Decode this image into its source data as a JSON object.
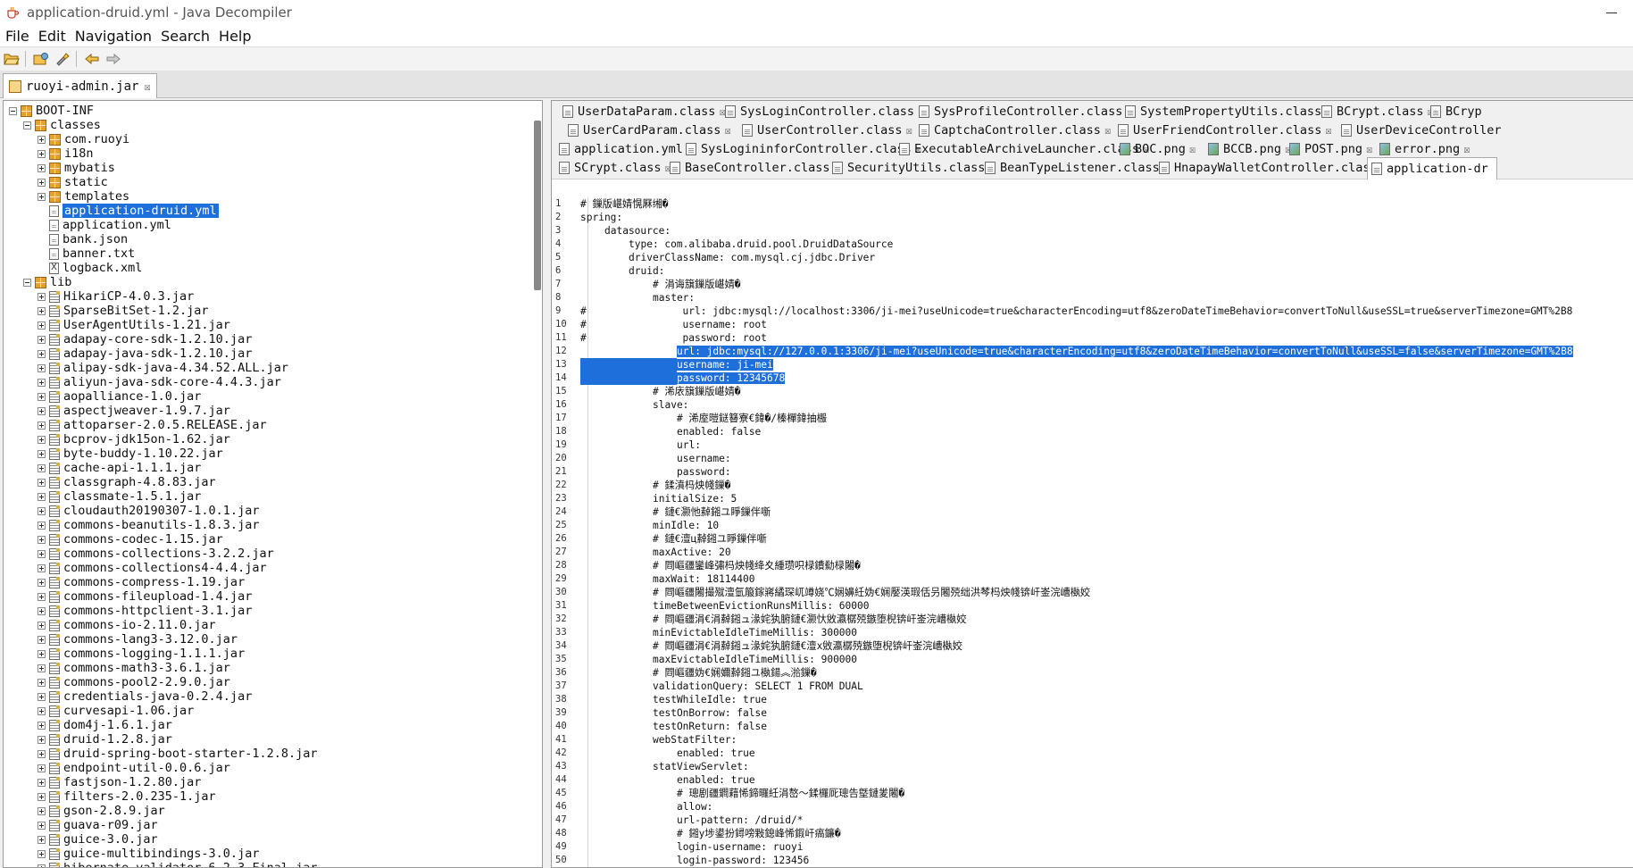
{
  "window": {
    "title": "application-druid.yml - Java Decompiler"
  },
  "menu": [
    "File",
    "Edit",
    "Navigation",
    "Search",
    "Help"
  ],
  "jar_tab": {
    "label": "ruoyi-admin.jar"
  },
  "tree": [
    {
      "label": "BOOT-INF",
      "depth": 0,
      "toggle": "minus",
      "icon": "package"
    },
    {
      "label": "classes",
      "depth": 1,
      "toggle": "minus",
      "icon": "package"
    },
    {
      "label": "com.ruoyi",
      "depth": 2,
      "toggle": "plus",
      "icon": "package"
    },
    {
      "label": "i18n",
      "depth": 2,
      "toggle": "plus",
      "icon": "package"
    },
    {
      "label": "mybatis",
      "depth": 2,
      "toggle": "plus",
      "icon": "package"
    },
    {
      "label": "static",
      "depth": 2,
      "toggle": "plus",
      "icon": "package"
    },
    {
      "label": "templates",
      "depth": 2,
      "toggle": "plus",
      "icon": "package"
    },
    {
      "label": "application-druid.yml",
      "depth": 2,
      "toggle": "none",
      "icon": "file",
      "selected": true
    },
    {
      "label": "application.yml",
      "depth": 2,
      "toggle": "none",
      "icon": "file"
    },
    {
      "label": "bank.json",
      "depth": 2,
      "toggle": "none",
      "icon": "file"
    },
    {
      "label": "banner.txt",
      "depth": 2,
      "toggle": "none",
      "icon": "file"
    },
    {
      "label": "logback.xml",
      "depth": 2,
      "toggle": "none",
      "icon": "xml"
    },
    {
      "label": "lib",
      "depth": 1,
      "toggle": "minus",
      "icon": "package"
    },
    {
      "label": "HikariCP-4.0.3.jar",
      "depth": 2,
      "toggle": "plus",
      "icon": "jar"
    },
    {
      "label": "SparseBitSet-1.2.jar",
      "depth": 2,
      "toggle": "plus",
      "icon": "jar"
    },
    {
      "label": "UserAgentUtils-1.21.jar",
      "depth": 2,
      "toggle": "plus",
      "icon": "jar"
    },
    {
      "label": "adapay-core-sdk-1.2.10.jar",
      "depth": 2,
      "toggle": "plus",
      "icon": "jar"
    },
    {
      "label": "adapay-java-sdk-1.2.10.jar",
      "depth": 2,
      "toggle": "plus",
      "icon": "jar"
    },
    {
      "label": "alipay-sdk-java-4.34.52.ALL.jar",
      "depth": 2,
      "toggle": "plus",
      "icon": "jar"
    },
    {
      "label": "aliyun-java-sdk-core-4.4.3.jar",
      "depth": 2,
      "toggle": "plus",
      "icon": "jar"
    },
    {
      "label": "aopalliance-1.0.jar",
      "depth": 2,
      "toggle": "plus",
      "icon": "jar"
    },
    {
      "label": "aspectjweaver-1.9.7.jar",
      "depth": 2,
      "toggle": "plus",
      "icon": "jar"
    },
    {
      "label": "attoparser-2.0.5.RELEASE.jar",
      "depth": 2,
      "toggle": "plus",
      "icon": "jar"
    },
    {
      "label": "bcprov-jdk15on-1.62.jar",
      "depth": 2,
      "toggle": "plus",
      "icon": "jar"
    },
    {
      "label": "byte-buddy-1.10.22.jar",
      "depth": 2,
      "toggle": "plus",
      "icon": "jar"
    },
    {
      "label": "cache-api-1.1.1.jar",
      "depth": 2,
      "toggle": "plus",
      "icon": "jar"
    },
    {
      "label": "classgraph-4.8.83.jar",
      "depth": 2,
      "toggle": "plus",
      "icon": "jar"
    },
    {
      "label": "classmate-1.5.1.jar",
      "depth": 2,
      "toggle": "plus",
      "icon": "jar"
    },
    {
      "label": "cloudauth20190307-1.0.1.jar",
      "depth": 2,
      "toggle": "plus",
      "icon": "jar"
    },
    {
      "label": "commons-beanutils-1.8.3.jar",
      "depth": 2,
      "toggle": "plus",
      "icon": "jar"
    },
    {
      "label": "commons-codec-1.15.jar",
      "depth": 2,
      "toggle": "plus",
      "icon": "jar"
    },
    {
      "label": "commons-collections-3.2.2.jar",
      "depth": 2,
      "toggle": "plus",
      "icon": "jar"
    },
    {
      "label": "commons-collections4-4.4.jar",
      "depth": 2,
      "toggle": "plus",
      "icon": "jar"
    },
    {
      "label": "commons-compress-1.19.jar",
      "depth": 2,
      "toggle": "plus",
      "icon": "jar"
    },
    {
      "label": "commons-fileupload-1.4.jar",
      "depth": 2,
      "toggle": "plus",
      "icon": "jar"
    },
    {
      "label": "commons-httpclient-3.1.jar",
      "depth": 2,
      "toggle": "plus",
      "icon": "jar"
    },
    {
      "label": "commons-io-2.11.0.jar",
      "depth": 2,
      "toggle": "plus",
      "icon": "jar"
    },
    {
      "label": "commons-lang3-3.12.0.jar",
      "depth": 2,
      "toggle": "plus",
      "icon": "jar"
    },
    {
      "label": "commons-logging-1.1.1.jar",
      "depth": 2,
      "toggle": "plus",
      "icon": "jar"
    },
    {
      "label": "commons-math3-3.6.1.jar",
      "depth": 2,
      "toggle": "plus",
      "icon": "jar"
    },
    {
      "label": "commons-pool2-2.9.0.jar",
      "depth": 2,
      "toggle": "plus",
      "icon": "jar"
    },
    {
      "label": "credentials-java-0.2.4.jar",
      "depth": 2,
      "toggle": "plus",
      "icon": "jar"
    },
    {
      "label": "curvesapi-1.06.jar",
      "depth": 2,
      "toggle": "plus",
      "icon": "jar"
    },
    {
      "label": "dom4j-1.6.1.jar",
      "depth": 2,
      "toggle": "plus",
      "icon": "jar"
    },
    {
      "label": "druid-1.2.8.jar",
      "depth": 2,
      "toggle": "plus",
      "icon": "jar"
    },
    {
      "label": "druid-spring-boot-starter-1.2.8.jar",
      "depth": 2,
      "toggle": "plus",
      "icon": "jar"
    },
    {
      "label": "endpoint-util-0.0.6.jar",
      "depth": 2,
      "toggle": "plus",
      "icon": "jar"
    },
    {
      "label": "fastjson-1.2.80.jar",
      "depth": 2,
      "toggle": "plus",
      "icon": "jar"
    },
    {
      "label": "filters-2.0.235-1.jar",
      "depth": 2,
      "toggle": "plus",
      "icon": "jar"
    },
    {
      "label": "gson-2.8.9.jar",
      "depth": 2,
      "toggle": "plus",
      "icon": "jar"
    },
    {
      "label": "guava-r09.jar",
      "depth": 2,
      "toggle": "plus",
      "icon": "jar"
    },
    {
      "label": "guice-3.0.jar",
      "depth": 2,
      "toggle": "plus",
      "icon": "jar"
    },
    {
      "label": "guice-multibindings-3.0.jar",
      "depth": 2,
      "toggle": "plus",
      "icon": "jar"
    },
    {
      "label": "hibernate-validator-6.2.3.Final.jar",
      "depth": 2,
      "toggle": "plus",
      "icon": "jar"
    }
  ],
  "editor_tabs": [
    [
      {
        "label": "UserDataParam.class",
        "icon": "class"
      },
      {
        "label": "SysLoginController.class",
        "icon": "class"
      },
      {
        "label": "SysProfileController.class",
        "icon": "class"
      },
      {
        "label": "SystemPropertyUtils.class",
        "icon": "class"
      },
      {
        "label": "BCrypt.class",
        "icon": "class"
      },
      {
        "label": "BCryp",
        "icon": "class",
        "closable": false
      }
    ],
    [
      {
        "label": "UserCardParam.class",
        "icon": "class"
      },
      {
        "label": "UserController.class",
        "icon": "class"
      },
      {
        "label": "CaptchaController.class",
        "icon": "class"
      },
      {
        "label": "UserFriendController.class",
        "icon": "class"
      },
      {
        "label": "UserDeviceController",
        "icon": "class",
        "closable": false
      }
    ],
    [
      {
        "label": "application.yml",
        "icon": "class"
      },
      {
        "label": "SysLogininforController.class",
        "icon": "class"
      },
      {
        "label": "ExecutableArchiveLauncher.class",
        "icon": "class"
      },
      {
        "label": "BOC.png",
        "icon": "png"
      },
      {
        "label": "BCCB.png",
        "icon": "png"
      },
      {
        "label": "POST.png",
        "icon": "png"
      },
      {
        "label": "error.png",
        "icon": "png"
      }
    ],
    [
      {
        "label": "SCrypt.class",
        "icon": "class"
      },
      {
        "label": "BaseController.class",
        "icon": "class"
      },
      {
        "label": "SecurityUtils.class",
        "icon": "class"
      },
      {
        "label": "BeanTypeListener.class",
        "icon": "class"
      },
      {
        "label": "HnapayWalletController.class",
        "icon": "class"
      },
      {
        "label": "application-dr",
        "icon": "class",
        "active": true,
        "closable": false
      }
    ]
  ],
  "code_lines": [
    {
      "n": "1",
      "text": "# 鏁版嵁婧愰厤缃�",
      "indent": 0
    },
    {
      "n": "2",
      "text": "spring:",
      "indent": 0
    },
    {
      "n": "3",
      "text": "datasource:",
      "indent": 4
    },
    {
      "n": "4",
      "text": "type: com.alibaba.druid.pool.DruidDataSource",
      "indent": 8
    },
    {
      "n": "5",
      "text": "driverClassName: com.mysql.cj.jdbc.Driver",
      "indent": 8
    },
    {
      "n": "6",
      "text": "druid:",
      "indent": 8
    },
    {
      "n": "7",
      "text": "# 涓诲簱鏁版嵁婧�",
      "indent": 12
    },
    {
      "n": "8",
      "text": "master:",
      "indent": 12
    },
    {
      "n": "9",
      "text": "#                url: jdbc:mysql://localhost:3306/ji-mei?useUnicode=true&characterEncoding=utf8&zeroDateTimeBehavior=convertToNull&useSSL=true&serverTimezone=GMT%2B8",
      "indent": 0
    },
    {
      "n": "10",
      "text": "#                username: root",
      "indent": 0
    },
    {
      "n": "11",
      "text": "#                password: root",
      "indent": 0
    },
    {
      "n": "12",
      "text": "url: jdbc:mysql://127.0.0.1:3306/ji-mei?useUnicode=true&characterEncoding=utf8&zeroDateTimeBehavior=convertToNull&useSSL=false&serverTimezone=GMT%2B8",
      "indent": 16,
      "highlight": true
    },
    {
      "n": "13",
      "text": "username: ji-mei",
      "indent": 16,
      "highlight": true
    },
    {
      "n": "14",
      "text": "password: 12345678",
      "indent": 16,
      "highlight": true
    },
    {
      "n": "15",
      "text": "# 浠庡簱鏁版嵁婧�",
      "indent": 12
    },
    {
      "n": "16",
      "text": "slave:",
      "indent": 12
    },
    {
      "n": "17",
      "text": "# 浠庢暟鎹簮寮€鍏�/榛樿鍏抽棴",
      "indent": 16
    },
    {
      "n": "18",
      "text": "enabled: false",
      "indent": 16
    },
    {
      "n": "19",
      "text": "url:",
      "indent": 16
    },
    {
      "n": "20",
      "text": "username:",
      "indent": 16
    },
    {
      "n": "21",
      "text": "password:",
      "indent": 16
    },
    {
      "n": "22",
      "text": "# 鍒濆杩炴帴鏁�",
      "indent": 12
    },
    {
      "n": "23",
      "text": "initialSize: 5",
      "indent": 12
    },
    {
      "n": "24",
      "text": "# 鏈€灏忚繛鎺ユ睜鏁伴噺",
      "indent": 12
    },
    {
      "n": "25",
      "text": "minIdle: 10",
      "indent": 12
    },
    {
      "n": "26",
      "text": "# 鏈€澶ц繛鎺ユ睜鏁伴噺",
      "indent": 12
    },
    {
      "n": "27",
      "text": "maxActive: 20",
      "indent": 12
    },
    {
      "n": "28",
      "text": "# 閰嶇疆鑾峰彇杩炴帴绛夊緟瓒呮椂鐨勬椂闂�",
      "indent": 12
    },
    {
      "n": "29",
      "text": "maxWait: 18114400",
      "indent": 12
    },
    {
      "n": "30",
      "text": "# 閰嶇疆闂撮殧澶氫箙鎵嶈繘琛屼竴娆℃娴嬶紝妫€娴嬮渶瑕佸叧闂殑绌洪棽杩炴帴锛屽崟浣嶆槸姣",
      "indent": 12
    },
    {
      "n": "31",
      "text": "timeBetweenEvictionRunsMillis: 60000",
      "indent": 12
    },
    {
      "n": "32",
      "text": "# 閰嶇疆涓€涓繛鎺ュ湪姹犱腑鏈€灏忕敓瀛樼殑鏃堕棿锛屽崟浣嶆槸姣",
      "indent": 12
    },
    {
      "n": "33",
      "text": "minEvictableIdleTimeMillis: 300000",
      "indent": 12
    },
    {
      "n": "34",
      "text": "# 閰嶇疆涓€涓繛鎺ュ湪姹犱腑鏈€澶х敓瀛樼殑鏃堕棿锛屽崟浣嶆槸姣",
      "indent": 12
    },
    {
      "n": "35",
      "text": "maxEvictableIdleTimeMillis: 900000",
      "indent": 12
    },
    {
      "n": "36",
      "text": "# 閰嶇疆妫€娴嬭繛鎺ユ槸鍚︽湁鏁�",
      "indent": 12
    },
    {
      "n": "37",
      "text": "validationQuery: SELECT 1 FROM DUAL",
      "indent": 12
    },
    {
      "n": "38",
      "text": "testWhileIdle: true",
      "indent": 12
    },
    {
      "n": "39",
      "text": "testOnBorrow: false",
      "indent": 12
    },
    {
      "n": "40",
      "text": "testOnReturn: false",
      "indent": 12
    },
    {
      "n": "41",
      "text": "webStatFilter:",
      "indent": 12
    },
    {
      "n": "42",
      "text": "enabled: true",
      "indent": 16
    },
    {
      "n": "43",
      "text": "statViewServlet:",
      "indent": 12
    },
    {
      "n": "44",
      "text": "enabled: true",
      "indent": 16
    },
    {
      "n": "45",
      "text": "# 璁剧疆鐧藉悕鍗曪紝涓嶅～鍒欏厑璁告墍鏈夎闂�",
      "indent": 16
    },
    {
      "n": "46",
      "text": "allow:",
      "indent": 16
    },
    {
      "n": "47",
      "text": "url-pattern: /druid/*",
      "indent": 16
    },
    {
      "n": "48",
      "text": "# 鎺у埗鍙扮鐞嗙敤鎴峰悕鍜屽瘑鐮�",
      "indent": 16
    },
    {
      "n": "49",
      "text": "login-username: ruoyi",
      "indent": 16
    },
    {
      "n": "50",
      "text": "login-password: 123456",
      "indent": 16
    }
  ],
  "colors": {
    "selection": "#1e6fd9"
  }
}
